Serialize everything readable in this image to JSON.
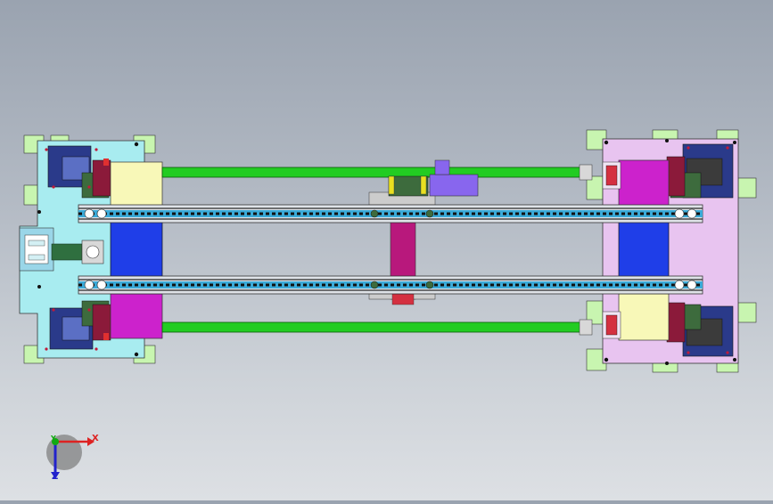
{
  "view": {
    "background_top": "#9aa3b0",
    "background_bottom": "#dde0e4",
    "colors": {
      "mint": "#c8f5b0",
      "cyan_plate": "#a8ecf0",
      "lilac_plate": "#e8c4f0",
      "green_shaft": "#22cc22",
      "yellow_block": "#f8f8b8",
      "blue_block": "#1f3ee8",
      "magenta_block": "#cc22cc",
      "motor": "#8866ee",
      "dark_blue": "#2a3a8a",
      "maroon": "#8b1a3a",
      "magenta_column": "#b8187c"
    }
  },
  "triad": {
    "x_label": "X",
    "y_label": "Y",
    "z_label": "Z"
  }
}
